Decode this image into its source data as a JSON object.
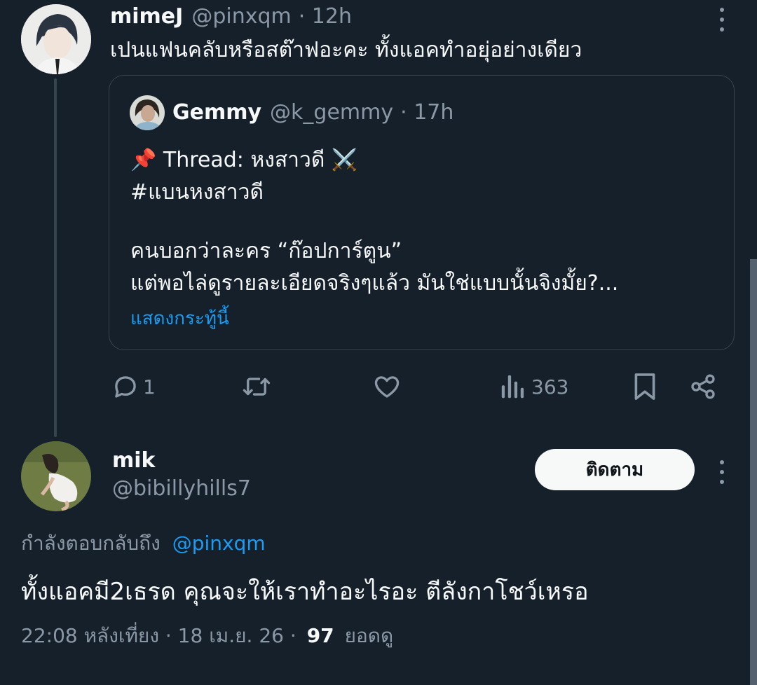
{
  "tweet1": {
    "name": "mimeJ",
    "handle": "@pinxqm",
    "time": "· 12h",
    "text": "เปนแฟนคลับหรือสต๊าฟอะคะ ทั้งแอคทำอยุ่อย่างเดียว"
  },
  "quote": {
    "name": "Gemmy",
    "handle": "@k_gemmy",
    "time": "· 17h",
    "pin_emoji": "📌",
    "line1_text": "Thread: หงสาวดี",
    "swords_emoji": "⚔️",
    "line2": "#แบนหงสาวดี",
    "line3": "คนบอกว่าละคร “ก๊อปการ์ตูน”",
    "line4": "แต่พอไล่ดูรายละเอียดจริงๆแล้ว มันใช่แบบนั้นจิงมั้ย?...",
    "show_more": "แสดงกระทู้นี้"
  },
  "actions": {
    "reply_count": "1",
    "views_count": "363"
  },
  "tweet2": {
    "name": "mik",
    "handle": "@bibillyhills7",
    "follow_label": "ติดตาม",
    "replying_prefix": "กำลังตอบกลับถึง",
    "replying_handle": "@pinxqm",
    "text": "ทั้งแอคมี2เธรด คุณจะให้เราทำอะไรอะ ตีลังกาโชว์เหรอ",
    "timestamp": "22:08 หลังเที่ยง · 18 เม.ย. 26 ·",
    "views_count": "97",
    "views_label": "ยอดดู"
  },
  "icons": [
    "more-icon",
    "reply-icon",
    "retweet-icon",
    "like-icon",
    "views-icon",
    "bookmark-icon",
    "share-icon"
  ],
  "colors": {
    "background": "#15202b",
    "text": "#f7f9f9",
    "muted": "#8b98a5",
    "link": "#1d9bf0",
    "border": "#38444d"
  }
}
